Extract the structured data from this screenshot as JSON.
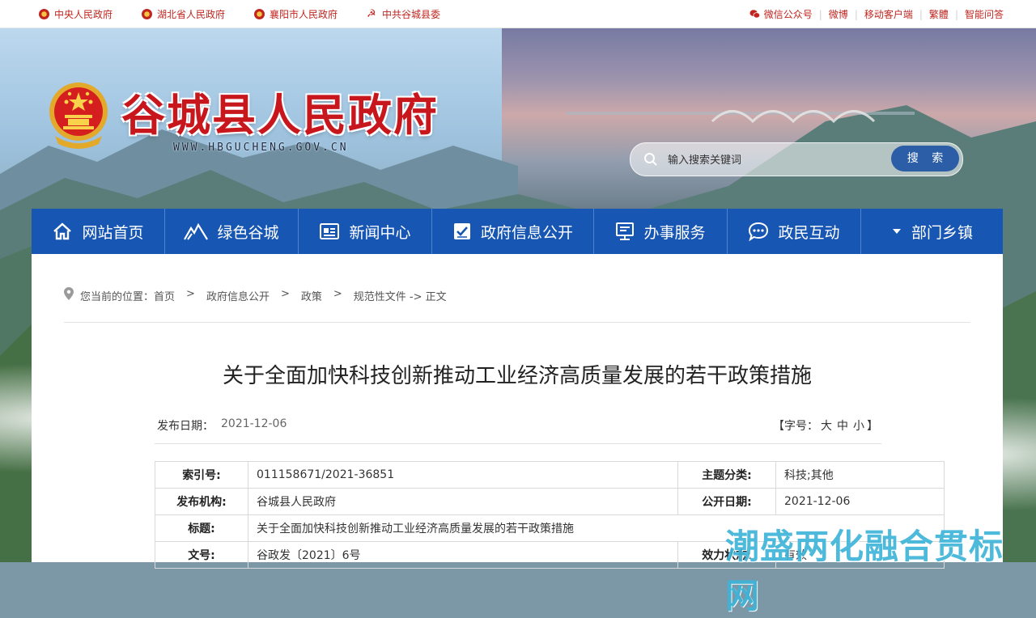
{
  "topbar": {
    "links": [
      "中央人民政府",
      "湖北省人民政府",
      "襄阳市人民政府",
      "中共谷城县委"
    ],
    "right_links": [
      "微信公众号",
      "微博",
      "移动客户端",
      "繁體",
      "智能问答"
    ]
  },
  "header": {
    "site_title": "谷城县人民政府",
    "site_url": "WWW.HBGUCHENG.GOV.CN"
  },
  "search": {
    "placeholder": "输入搜索关键词",
    "button_label": "搜 索"
  },
  "nav": {
    "items": [
      "网站首页",
      "绿色谷城",
      "新闻中心",
      "政府信息公开",
      "办事服务",
      "政民互动",
      "部门乡镇"
    ]
  },
  "breadcrumb": {
    "prefix": "您当前的位置：",
    "items": [
      "首页",
      "政府信息公开",
      "政策",
      "规范性文件 -> 正文"
    ],
    "separator": ">"
  },
  "article": {
    "title": "关于全面加快科技创新推动工业经济高质量发展的若干政策措施",
    "date_label": "发布日期：",
    "date": "2021-12-06",
    "font_size_label": "【字号：",
    "font_sizes": [
      "大",
      "中",
      "小"
    ],
    "font_size_close": "】"
  },
  "info_table": {
    "rows": [
      {
        "label": "索引号:",
        "value": "011158671/2021-36851",
        "label2": "主题分类:",
        "value2": "科技;其他"
      },
      {
        "label": "发布机构:",
        "value": "谷城县人民政府",
        "label2": "公开日期:",
        "value2": "2021-12-06"
      },
      {
        "label": "标题:",
        "value": "关于全面加快科技创新推动工业经济高质量发展的若干政策措施"
      },
      {
        "label": "文号:",
        "value": "谷政发〔2021〕6号",
        "label2": "效力状态:",
        "value2": "有效"
      }
    ]
  },
  "watermark": "潮盛两化融合贯标网",
  "colors": {
    "brand_red": "#c8161d",
    "nav_blue": "#1756b3",
    "search_button": "#2c5ea8"
  }
}
